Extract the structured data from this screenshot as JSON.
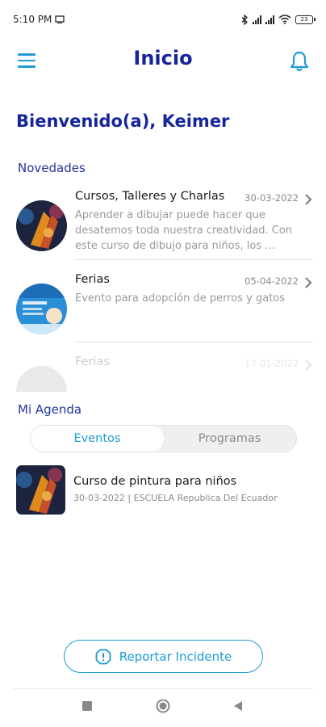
{
  "status_bar": {
    "time": "5:10 PM",
    "battery": "23",
    "icons": [
      "screen-icon",
      "bluetooth-icon",
      "signal-icon",
      "signal-icon",
      "wifi-icon",
      "battery-icon"
    ]
  },
  "header": {
    "title": "Inicio",
    "menu_icon": "hamburger-menu-icon",
    "notifications_icon": "bell-icon"
  },
  "welcome": "Bienvenido(a), Keimer",
  "news": {
    "label": "Novedades",
    "items": [
      {
        "title": "Cursos, Talleres y Charlas",
        "date": "30-03-2022",
        "description": "Aprender a dibujar puede hacer que desatemos toda nuestra creatividad. Con este curso de dibujo para niños, los …"
      },
      {
        "title": "Ferias",
        "date": "05-04-2022",
        "description": "Evento para adopción de perros y gatos"
      },
      {
        "title": "Ferias",
        "date": "17-01-2022",
        "description": ""
      }
    ]
  },
  "agenda": {
    "label": "Mi Agenda",
    "tabs": [
      {
        "label": "Eventos",
        "active": true
      },
      {
        "label": "Programas",
        "active": false
      }
    ],
    "items": [
      {
        "title": "Curso de pintura para niños",
        "subtitle": "30-03-2022 | ESCUELA Republica Del Ecuador"
      }
    ]
  },
  "report_button": {
    "label": "Reportar Incidente",
    "icon": "alert-octagon-icon"
  },
  "colors": {
    "brand_navy": "#16269a",
    "accent_blue": "#1e9bd7",
    "muted_text": "#9a9a9a"
  }
}
